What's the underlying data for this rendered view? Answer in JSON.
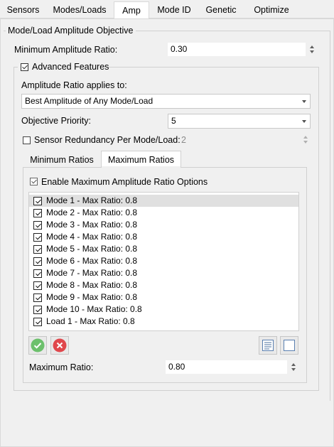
{
  "tabs": [
    "Sensors",
    "Modes/Loads",
    "Amp",
    "Mode ID",
    "Genetic",
    "Optimize"
  ],
  "active_tab": "Amp",
  "group_title": "Mode/Load Amplitude Objective",
  "min_amp": {
    "label": "Minimum Amplitude Ratio:",
    "value": "0.30"
  },
  "advanced": {
    "label": "Advanced Features",
    "checked": true,
    "applies_label": "Amplitude Ratio applies to:",
    "applies_value": "Best Amplitude of Any Mode/Load",
    "priority_label": "Objective Priority:",
    "priority_value": "5",
    "redundancy_label": "Sensor Redundancy Per Mode/Load:",
    "redundancy_value": "2",
    "redundancy_checked": false
  },
  "subtabs": [
    "Minimum Ratios",
    "Maximum Ratios"
  ],
  "active_subtab": "Maximum Ratios",
  "enable_max_label": "Enable Maximum Amplitude Ratio Options",
  "list_items": [
    "Mode 1 - Max Ratio: 0.8",
    "Mode 2 - Max Ratio: 0.8",
    "Mode 3 - Max Ratio: 0.8",
    "Mode 4 - Max Ratio: 0.8",
    "Mode 5 - Max Ratio: 0.8",
    "Mode 6 - Max Ratio: 0.8",
    "Mode 7 - Max Ratio: 0.8",
    "Mode 8 - Max Ratio: 0.8",
    "Mode 9 - Max Ratio: 0.8",
    "Mode 10 - Max Ratio: 0.8",
    "Load 1 - Max Ratio: 0.8"
  ],
  "max_ratio": {
    "label": "Maximum Ratio:",
    "value": "0.80"
  },
  "icons": {
    "accept": "check-circle-icon",
    "reject": "x-circle-icon",
    "select_all": "checked-list-icon",
    "clear_all": "empty-square-icon"
  },
  "colors": {
    "accept_green": "#6cc06c",
    "reject_red": "#e0474c"
  }
}
